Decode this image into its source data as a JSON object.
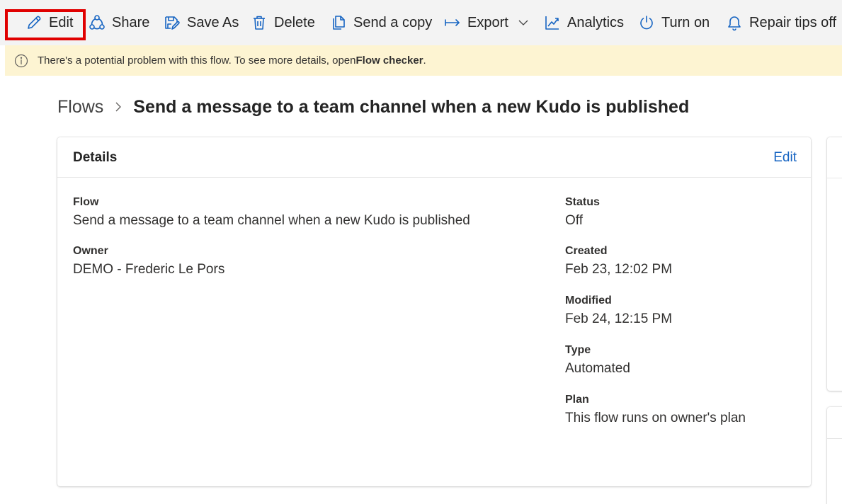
{
  "toolbar": {
    "edit": "Edit",
    "share": "Share",
    "save_as": "Save As",
    "delete": "Delete",
    "send_copy": "Send a copy",
    "export": "Export",
    "analytics": "Analytics",
    "turn_on": "Turn on",
    "repair_tips": "Repair tips off"
  },
  "banner": {
    "message": "There's a potential problem with this flow. To see more details, open ",
    "link": "Flow checker",
    "end": "."
  },
  "breadcrumb": {
    "root": "Flows",
    "current": "Send a message to a team channel when a new Kudo is published"
  },
  "details": {
    "title": "Details",
    "edit_label": "Edit",
    "flow_label": "Flow",
    "flow_value": "Send a message to a team channel when a new Kudo is published",
    "owner_label": "Owner",
    "owner_value": "DEMO - Frederic Le Pors",
    "status_label": "Status",
    "status_value": "Off",
    "created_label": "Created",
    "created_value": "Feb 23, 12:02 PM",
    "modified_label": "Modified",
    "modified_value": "Feb 24, 12:15 PM",
    "type_label": "Type",
    "type_value": "Automated",
    "plan_label": "Plan",
    "plan_value": "This flow runs on owner's plan"
  },
  "icons": {
    "edit": "pencil-icon",
    "share": "share-icon",
    "save_as": "save-as-icon",
    "delete": "trash-icon",
    "send_copy": "copy-icon",
    "export": "export-arrow-icon",
    "analytics": "chart-line-icon",
    "turn_on": "power-icon",
    "repair_tips": "bell-icon",
    "info": "info-icon"
  },
  "colors": {
    "accent": "#1664c2",
    "highlight": "#e00000",
    "banner_bg": "#fdf4d2",
    "toolbar_bg": "#f3f3f3"
  }
}
